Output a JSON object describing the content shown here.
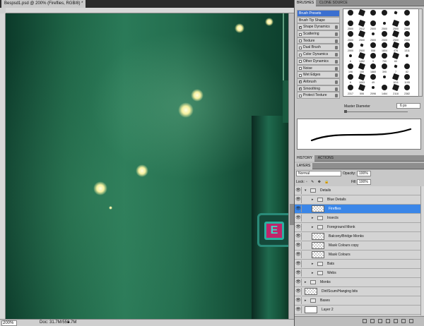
{
  "document": {
    "tab_title": "Bespsd1.psd @ 200% (Fireflies, RGB/8) *",
    "zoom": "200%",
    "doc_size": "Doc: 31.7M/558.7M",
    "sign_glyph": "E"
  },
  "brushes_panel": {
    "tabs": [
      "BRUSHES",
      "CLONE SOURCE"
    ],
    "options": [
      {
        "label": "Brush Presets",
        "type": "head"
      },
      {
        "label": "Brush Tip Shape",
        "type": "plain"
      },
      {
        "label": "Shape Dynamics",
        "checked": true
      },
      {
        "label": "Scattering",
        "checked": false
      },
      {
        "label": "Texture",
        "checked": false
      },
      {
        "label": "Dual Brush",
        "checked": false
      },
      {
        "label": "Color Dynamics",
        "checked": false
      },
      {
        "label": "Other Dynamics",
        "checked": false
      },
      {
        "label": "Noise",
        "checked": false
      },
      {
        "label": "Wet Edges",
        "checked": false
      },
      {
        "label": "Airbrush",
        "checked": true
      },
      {
        "label": "Smoothing",
        "checked": true
      },
      {
        "label": "Protect Texture",
        "checked": false
      }
    ],
    "preset_sizes": [
      "",
      "",
      "",
      "",
      "",
      "",
      "2500",
      "2512",
      "2500",
      "2500",
      "2500",
      "2500",
      "2500",
      "2500",
      "2500",
      "2500",
      "2500",
      "2500",
      "2500",
      "2500",
      "558",
      "1804",
      "476",
      "1311",
      "6",
      "1452",
      "9",
      "700",
      "60",
      "",
      "196",
      "100",
      "1860",
      "395",
      "7",
      "82",
      "6",
      "1003",
      "49",
      "",
      "1011",
      "1105",
      "2317",
      "506",
      "2096",
      "1464",
      "2118",
      "2382"
    ],
    "master_diameter_label": "Master Diameter",
    "master_diameter_value": "6 px"
  },
  "history_panel": {
    "tabs": [
      "HISTORY",
      "ACTIONS"
    ]
  },
  "layers_panel": {
    "tabs": [
      "LAYERS"
    ],
    "blend_mode": "Normal",
    "opacity_label": "Opacity:",
    "opacity_value": "100%",
    "lock_label": "Lock:",
    "lock_icons": "▫ ✎ ✥ 🔒",
    "fill_label": "Fill:",
    "fill_value": "100%",
    "layers": [
      {
        "name": "Details",
        "kind": "folder",
        "indent": 0,
        "open": true
      },
      {
        "name": "Blue Details",
        "kind": "folder",
        "indent": 1,
        "open": false
      },
      {
        "name": "Fireflies",
        "kind": "layer",
        "indent": 1,
        "selected": true
      },
      {
        "name": "Insects",
        "kind": "folder",
        "indent": 1,
        "open": false
      },
      {
        "name": "Foreground Monk",
        "kind": "folder",
        "indent": 1,
        "open": false
      },
      {
        "name": "Balcony/Bridge Monks",
        "kind": "layer",
        "indent": 1
      },
      {
        "name": "Mask Colours copy",
        "kind": "layer",
        "indent": 1
      },
      {
        "name": "Mask Colours",
        "kind": "layer",
        "indent": 1
      },
      {
        "name": "Bats",
        "kind": "folder",
        "indent": 1,
        "open": false
      },
      {
        "name": "Webs",
        "kind": "folder",
        "indent": 1,
        "open": false
      },
      {
        "name": "Monks",
        "kind": "folder",
        "indent": 0,
        "open": false
      },
      {
        "name": "Dirt/Scum/Hanging bits",
        "kind": "layer",
        "indent": 0
      },
      {
        "name": "Bases",
        "kind": "folder",
        "indent": 0,
        "open": false
      },
      {
        "name": "Layer 2",
        "kind": "white",
        "indent": 0
      }
    ]
  }
}
